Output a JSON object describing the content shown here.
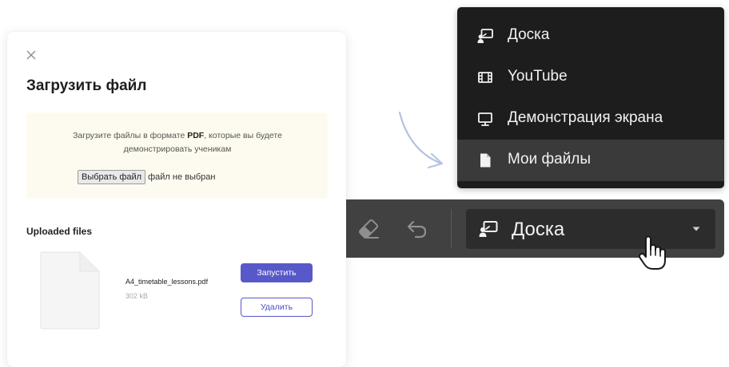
{
  "upload_modal": {
    "title": "Загрузить файл",
    "hint_prefix": "Загрузите файлы в формате ",
    "hint_format": "PDF",
    "hint_suffix": ", которые вы будете демонстрировать ученикам",
    "choose_file_label": "Выбрать файл",
    "no_file_text": "файл не выбран",
    "uploaded_title": "Uploaded files",
    "files": [
      {
        "name": "A4_timetable_lessons.pdf",
        "size": "302 kB",
        "launch_label": "Запустить",
        "delete_label": "Удалить"
      }
    ]
  },
  "toolbar": {
    "current_mode": "Доска",
    "icons": [
      "eraser-icon",
      "undo-icon",
      "whiteboard-icon",
      "caret-down-icon"
    ]
  },
  "mode_menu": {
    "items": [
      {
        "label": "Доска",
        "icon": "whiteboard-icon"
      },
      {
        "label": "YouTube",
        "icon": "film-icon"
      },
      {
        "label": "Демонстрация экрана",
        "icon": "monitor-icon"
      },
      {
        "label": "Мои файлы",
        "icon": "file-icon"
      }
    ],
    "highlighted_index": 3
  },
  "colors": {
    "primary": "#5759c9",
    "toolbar_bg": "#414141",
    "menu_bg": "#1d1d1d",
    "upload_box_bg": "#fdfbef",
    "arrow": "#b4c3e1"
  }
}
